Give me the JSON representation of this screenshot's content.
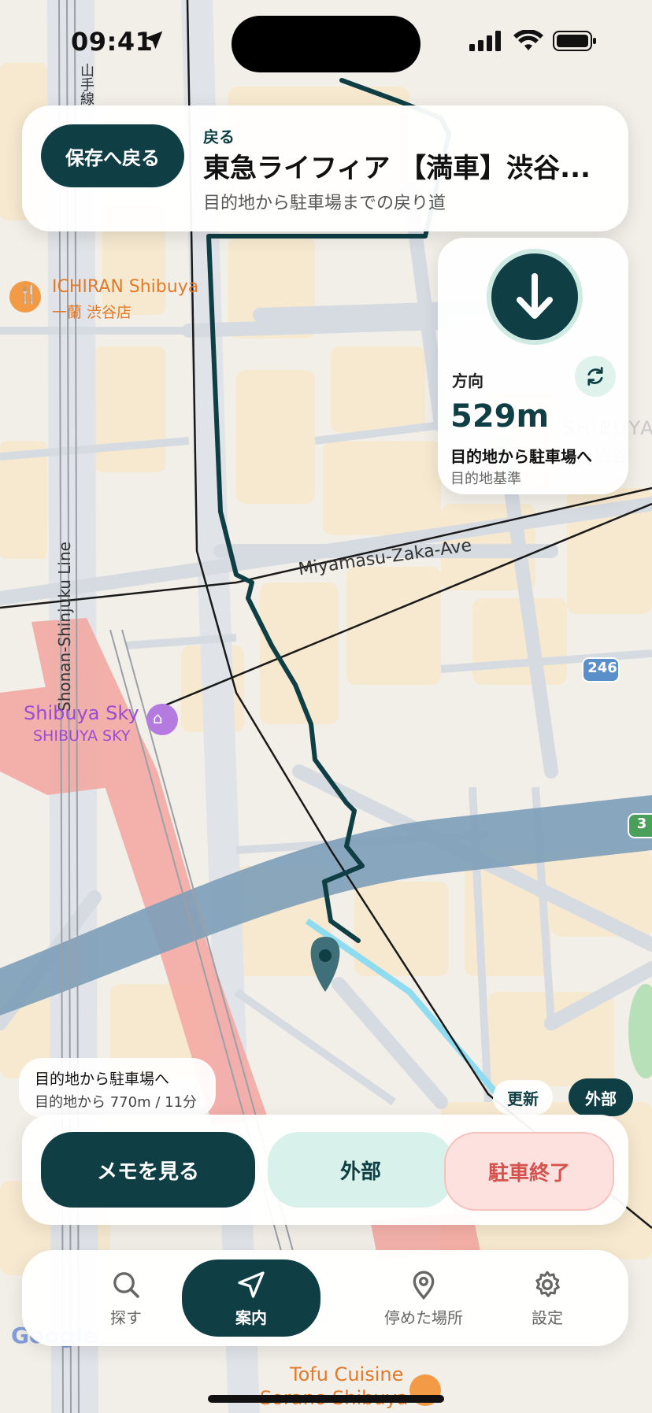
{
  "status_bar": {
    "time": "09:41"
  },
  "map": {
    "poi_ichiran_name": "ICHIRAN Shibuya",
    "poi_ichiran_jp": "一蘭 渋谷店",
    "line_label": "Shonan-Shinjuku Line",
    "line_label_yamanote": "山手線",
    "avenue_label": "Miyamasu-Zaka-Ave",
    "poi_sky_name": "Shibuya Sky",
    "poi_sky_en": "SHIBUYA SKY",
    "route_shield": "246",
    "route_shield_2": "3",
    "district_label": "SHIBUYA",
    "district_label_jp": "渋谷",
    "poi_tofu_line1": "Tofu Cuisine",
    "poi_tofu_line2": "Sorano Shibuya",
    "attribution": "Google",
    "colors": {
      "route": "#0f3f45",
      "river": "#7f9fb8",
      "rail_area": "#f4a6a0",
      "block": "#f6e9cf",
      "road": "#d7dce2"
    }
  },
  "top_card": {
    "back_button": "保存へ戻る",
    "kicker": "戻る",
    "title": "東急ライフィア 【満車】渋谷...",
    "subtitle": "目的地から駐車場までの戻り道"
  },
  "direction_card": {
    "arrow_icon": "arrow-down-icon",
    "label": "方向",
    "distance": "529m",
    "description": "目的地から駐車場へ",
    "note": "目的地基準"
  },
  "info_pill": {
    "title": "目的地から駐車場へ",
    "subtitle": "目的地から 770m / 11分"
  },
  "map_controls": {
    "update": "更新",
    "external": "外部"
  },
  "actions": {
    "memo": "メモを見る",
    "external": "外部",
    "end_parking": "駐車終了"
  },
  "tabs": [
    {
      "label": "探す",
      "icon": "search-icon"
    },
    {
      "label": "案内",
      "icon": "navigation-arrow-icon"
    },
    {
      "label": "停めた場所",
      "icon": "location-pin-icon"
    },
    {
      "label": "設定",
      "icon": "gear-icon"
    }
  ]
}
